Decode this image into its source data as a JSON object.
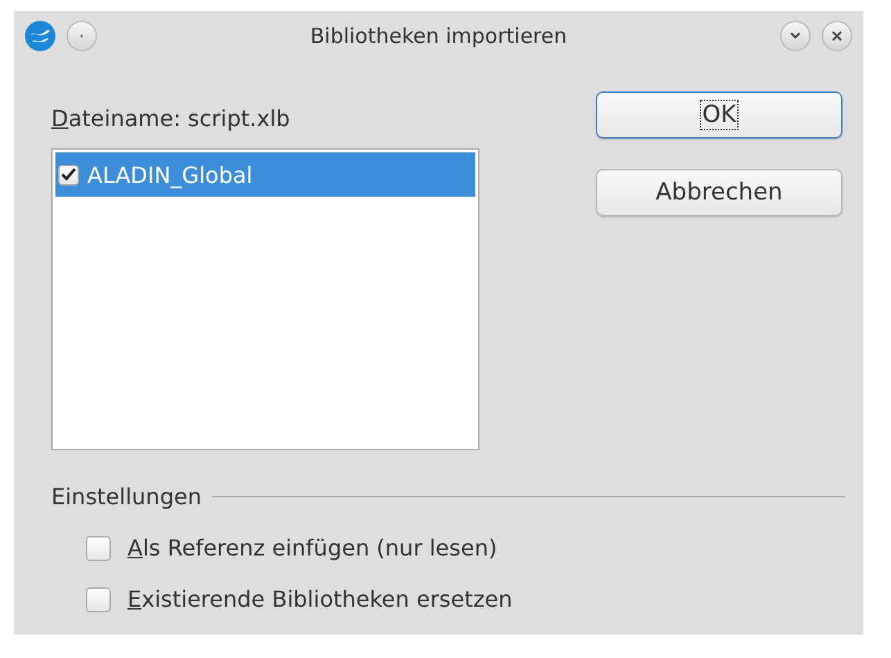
{
  "window": {
    "title": "Bibliotheken importieren"
  },
  "file_label": {
    "text": "Dateiname: script.xlb",
    "underline_first": true
  },
  "libraries": [
    {
      "label": "ALADIN_Global",
      "checked": true,
      "selected": true
    }
  ],
  "buttons": [
    {
      "label": "OK",
      "default": true
    },
    {
      "label": "Abbrechen",
      "default": false
    }
  ],
  "settings": {
    "title": "Einstellungen",
    "options": [
      {
        "label": "Als Referenz einfügen (nur lesen)",
        "checked": false,
        "underline_first": true
      },
      {
        "label": "Existierende Bibliotheken ersetzen",
        "checked": false,
        "underline_first": true
      }
    ]
  }
}
